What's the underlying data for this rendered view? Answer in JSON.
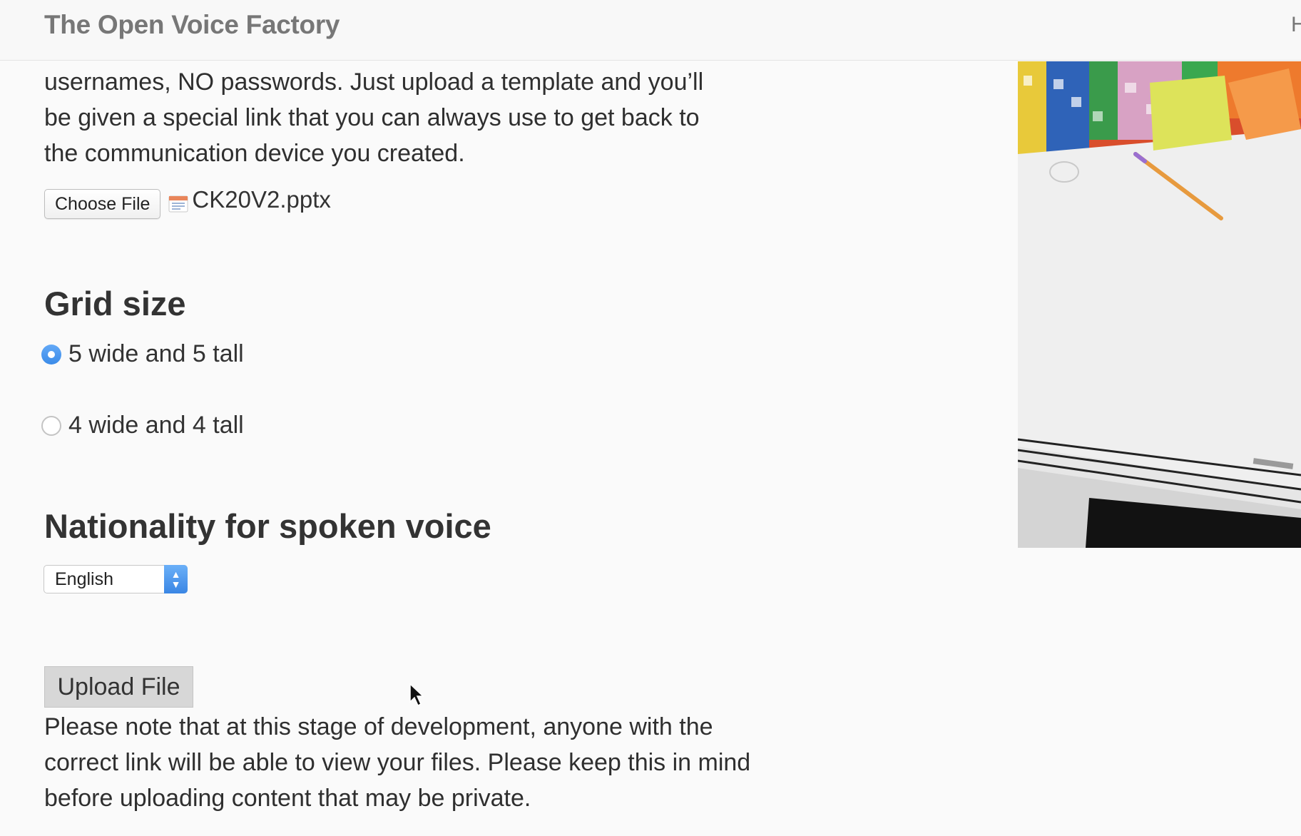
{
  "header": {
    "brand": "The Open Voice Factory",
    "nav_cut": "H"
  },
  "intro": {
    "text": "usernames, NO passwords. Just upload a template and you’ll be given a special link that you can always use to get back to the communication device you created."
  },
  "file_input": {
    "button_label": "Choose File",
    "file_name": "CK20V2.pptx"
  },
  "grid_size": {
    "heading": "Grid size",
    "options": [
      {
        "label": "5 wide and 5 tall",
        "selected": true
      },
      {
        "label": "4 wide and 4 tall",
        "selected": false
      }
    ]
  },
  "nationality": {
    "heading": "Nationality for spoken voice",
    "selected": "English"
  },
  "upload": {
    "button_label": "Upload File"
  },
  "note": {
    "text": "Please note that at this stage of development, anyone with the correct link will be able to view your files. Please keep this in mind before uploading content that may be private."
  },
  "colors": {
    "accent_blue": "#3b8be8",
    "upload_button_bg": "#d7d7d7",
    "brand_text": "#777777"
  },
  "icons": {
    "file": "file-icon",
    "select_arrows": "chevron-updown-icon",
    "cursor": "mouse-pointer-icon"
  }
}
